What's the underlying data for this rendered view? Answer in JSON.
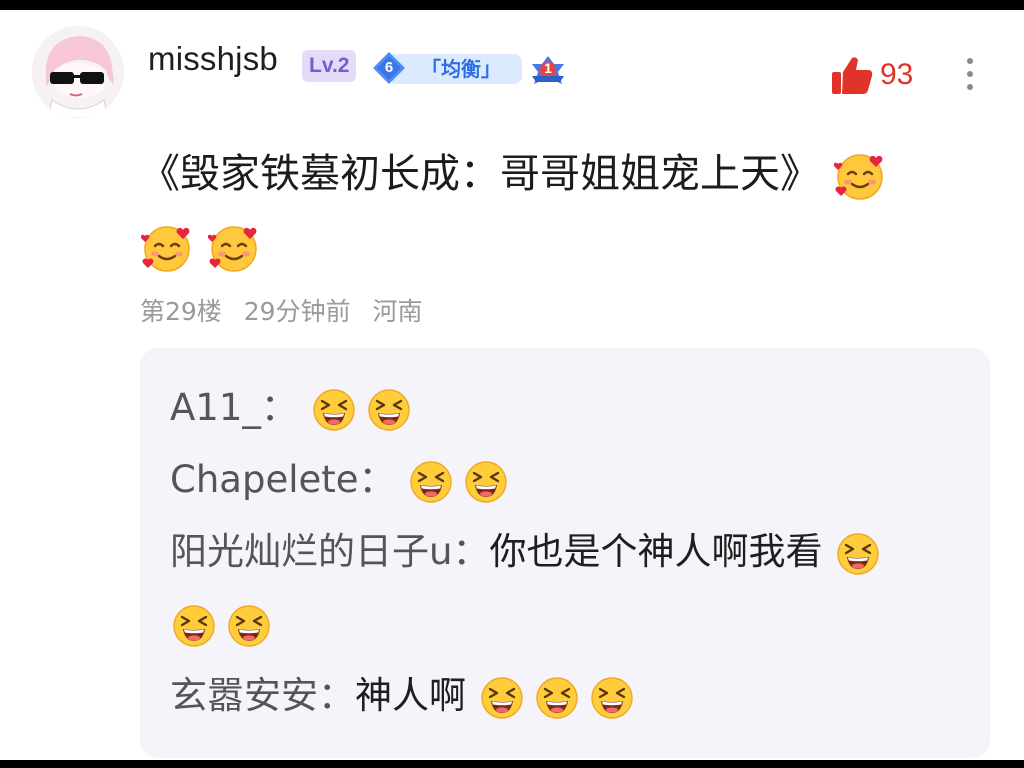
{
  "user": {
    "name": "misshjsb",
    "level": "Lv.2",
    "tag_number": "6",
    "tag_label": "「均衡」",
    "rank_number": "1"
  },
  "like": {
    "count": "93",
    "color": "#e0342b"
  },
  "post": {
    "text": "《毁家铁墓初长成：哥哥姐姐宠上天》",
    "emoji": "smiling-face-with-hearts"
  },
  "meta": {
    "floor": "第29楼",
    "time": "29分钟前",
    "location": "河南"
  },
  "replies": [
    {
      "author": "A11_：",
      "text": "",
      "emoji": "grinning-squinting-face"
    },
    {
      "author": "Chapelete：",
      "text": "",
      "emoji": "grinning-squinting-face"
    },
    {
      "author": "阳光灿烂的日子u：",
      "text": "你也是个神人啊我看",
      "emoji": "grinning-squinting-face"
    },
    {
      "author": "玄嚣安安：",
      "text": "神人啊",
      "emoji": "grinning-squinting-face"
    }
  ],
  "colors": {
    "reply_background": "#f4f4fa",
    "meta_text": "#9a9a9a",
    "level_badge": "#7a5bd1",
    "tag_badge": "#2f6fe4"
  }
}
